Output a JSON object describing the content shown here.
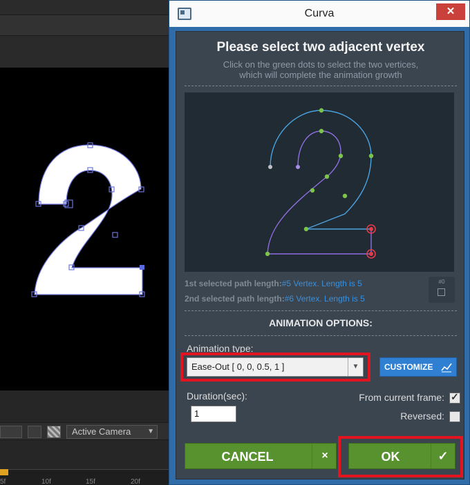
{
  "background_app": {
    "camera_select": "Active Camera",
    "ruler_ticks": [
      "5f",
      "10f",
      "15f",
      "20f"
    ]
  },
  "dialog": {
    "title": "Curva",
    "close_glyph": "✕",
    "heading": "Please select two adjacent vertex",
    "subheading_line1": "Click on the green dots to select the two vertices,",
    "subheading_line2": "which will complete the animation growth",
    "path_info": [
      {
        "label": "1st selected path length:",
        "value": "#5 Vertex. Length is 5"
      },
      {
        "label": "2nd selected path length:",
        "value": "#6 Vertex. Length is 5"
      }
    ],
    "reset_badge": "#0",
    "options_heading": "ANIMATION OPTIONS:",
    "animation_type_label": "Animation type:",
    "animation_type_value": "Ease-Out [ 0, 0, 0.5, 1 ]",
    "customize_label": "CUSTOMIZE",
    "duration_label": "Duration(sec):",
    "duration_value": "1",
    "from_current_frame_label": "From current frame:",
    "from_current_frame_checked": true,
    "reversed_label": "Reversed:",
    "reversed_checked": false,
    "cancel_label": "CANCEL",
    "cancel_icon": "×",
    "ok_label": "OK",
    "ok_icon": "✓"
  },
  "colors": {
    "accent_blue": "#2f80d3",
    "button_green": "#58922e",
    "highlight_red": "#e1141f",
    "path_blue": "#4aa3e0",
    "path_purple": "#8f6fe0",
    "vertex_green": "#7cc44a"
  }
}
